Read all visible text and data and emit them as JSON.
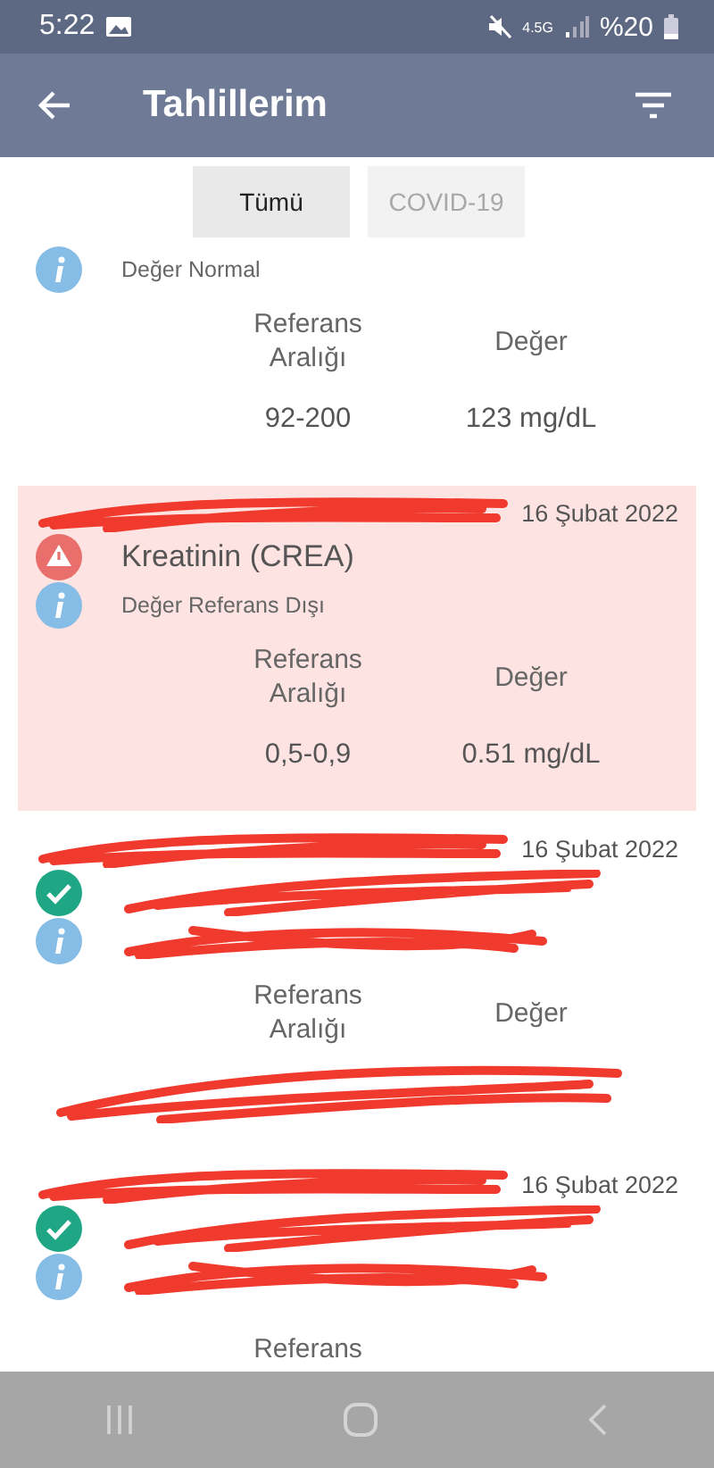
{
  "status_bar": {
    "time": "5:22",
    "network": "4.5G",
    "battery": "%20"
  },
  "app_bar": {
    "title": "Tahlillerim"
  },
  "tabs": [
    {
      "label": "Tümü",
      "selected": true
    },
    {
      "label": "COVID-19",
      "selected": false
    }
  ],
  "results": [
    {
      "highlighted": false,
      "note": "Değer Normal",
      "ref_header": "Referans Aralığı",
      "value_header": "Değer",
      "ref": "92-200",
      "value": "123 mg/dL"
    },
    {
      "highlighted": true,
      "date": "16 Şubat 2022",
      "kind": "alert",
      "title": "Kreatinin (CREA)",
      "note": "Değer Referans Dışı",
      "ref_header": "Referans Aralığı",
      "value_header": "Değer",
      "ref": "0,5-0,9",
      "value": "0.51 mg/dL",
      "source_covered": true
    },
    {
      "highlighted": false,
      "date": "16 Şubat 2022",
      "kind": "ok",
      "ref_header": "Referans Aralığı",
      "value_header": "Değer",
      "source_covered": true,
      "title_covered": true,
      "note_covered": true,
      "values_covered": true
    },
    {
      "highlighted": false,
      "date": "16 Şubat 2022",
      "kind": "ok",
      "ref_header": "Referans",
      "source_covered": true,
      "title_covered": true,
      "note_covered": true
    }
  ]
}
